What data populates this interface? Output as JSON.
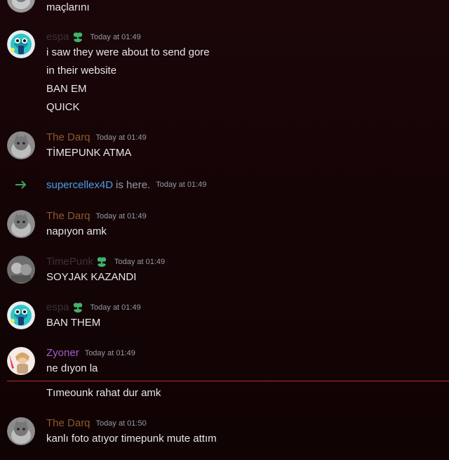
{
  "messages": [
    {
      "author": "",
      "time": "",
      "lines": [
        "maçlarını"
      ]
    },
    {
      "author": "espa",
      "time": "Today at 01:49",
      "lines": [
        "i saw they were about to send gore",
        "in their website",
        "BAN EM",
        "QUICK"
      ]
    },
    {
      "author": "The Darq",
      "time": "Today at 01:49",
      "lines": [
        "TİMEPUNK ATMA"
      ]
    },
    {
      "author": "The Darq",
      "time": "Today at 01:49",
      "lines": [
        "napıyon amk"
      ]
    },
    {
      "author": "TimePunk",
      "time": "Today at 01:49",
      "lines": [
        "SOYJAK KAZANDI"
      ]
    },
    {
      "author": "espa",
      "time": "Today at 01:49",
      "lines": [
        "BAN THEM"
      ]
    },
    {
      "author": "Zyoner",
      "time": "Today at 01:49",
      "lines": [
        "ne dıyon la",
        "Tımeounk rahat dur amk"
      ]
    },
    {
      "author": "The Darq",
      "time": "Today at 01:50",
      "lines": [
        "kanlı foto atıyor timepunk mute attım"
      ]
    }
  ],
  "join": {
    "user": "supercellex4D",
    "text": "is here.",
    "time": "Today at 01:49"
  },
  "colors": {
    "espa": "#3a3036",
    "darq": "#8a5a2e",
    "timepunk": "#3e3236",
    "zyoner": "#a35ccf",
    "join_user": "#4a9ee8",
    "new_divider": "#f23f43",
    "badge": "#3fb36b",
    "join_arrow": "#3ba55c"
  },
  "icons": {
    "badge": "sprout-badge-icon",
    "join": "arrow-right-icon"
  }
}
